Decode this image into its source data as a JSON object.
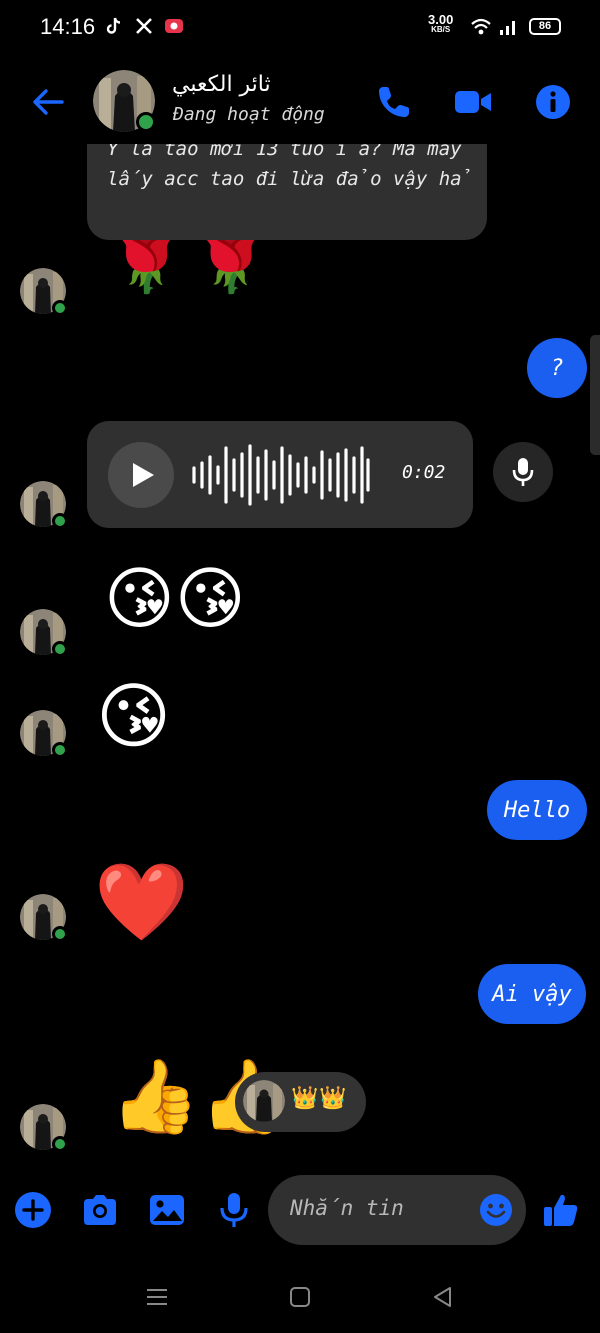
{
  "status_bar": {
    "time": "14:16",
    "net_speed": "3.00",
    "net_unit": "KB/S",
    "battery": "86",
    "app_icons": [
      "tiktok-icon",
      "x-icon",
      "recorder-icon"
    ]
  },
  "header": {
    "contact_name": "ثائر الكعبي",
    "status": "Đang hoạt động",
    "actions": [
      "call-icon",
      "video-call-icon",
      "info-icon"
    ]
  },
  "messages": {
    "clipped_text_line1": "Y là tao mới 13 tuổi à? Mà mày",
    "clipped_text_line2": "lấy acc tao đi lừa đảo vậy hả",
    "roses": "🌹🌹",
    "question_out": "?",
    "voice_duration": "0:02",
    "kiss_pair": "😘😘",
    "kiss_single": "😘",
    "hello_out": "Hello",
    "heart": "❤️",
    "ai_vay_out": "Ai vậy",
    "thumbs": "👍👍",
    "reaction_emojis": "👑👑"
  },
  "composer": {
    "placeholder": "Nhắn tin"
  },
  "colors": {
    "accent": "#1a5ff0",
    "incoming_bubble": "#303030",
    "online": "#31a24c",
    "background": "#000000"
  }
}
